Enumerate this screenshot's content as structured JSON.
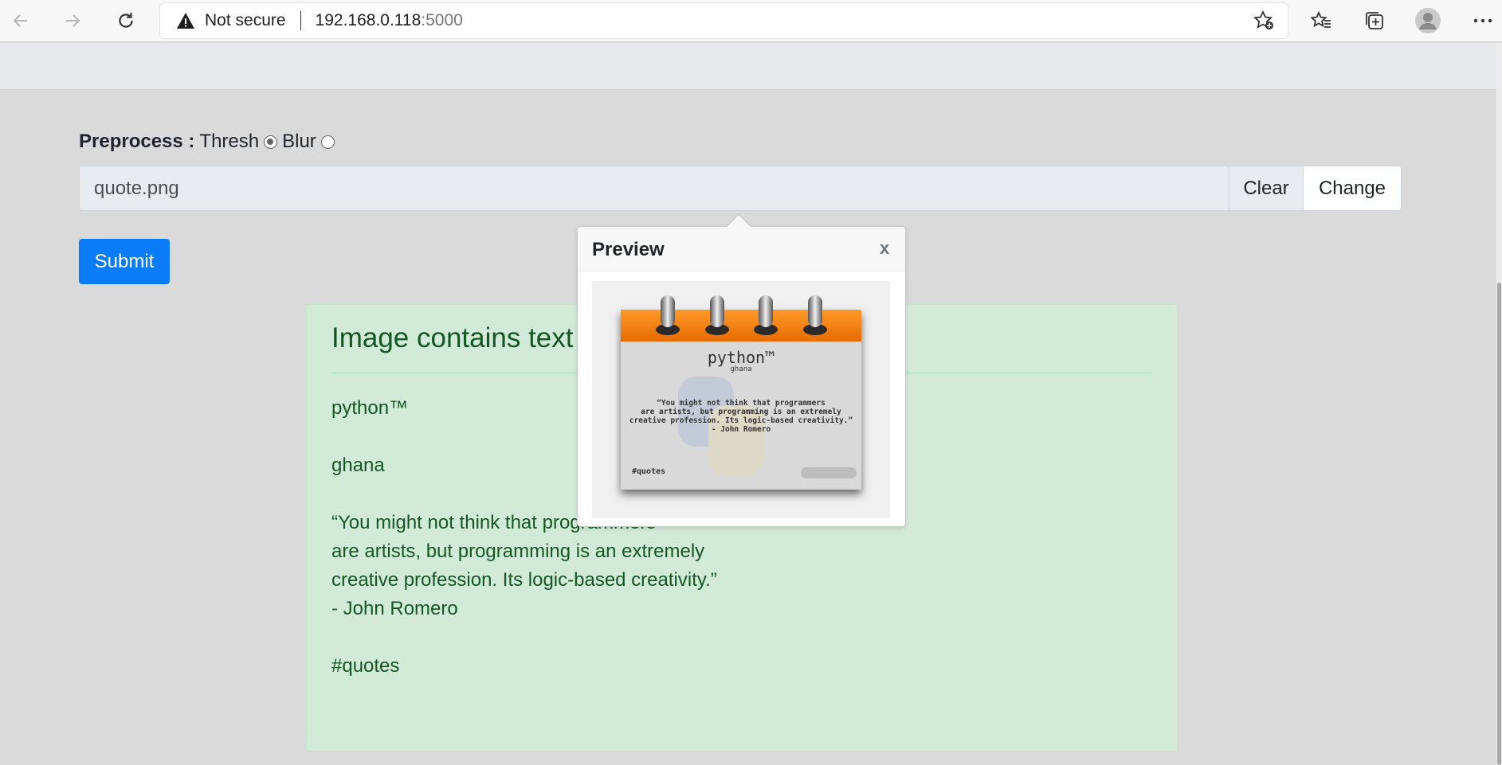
{
  "browser": {
    "security_label": "Not secure",
    "url_host": "192.168.0.118",
    "url_port": ":5000",
    "icons": [
      "back-icon",
      "forward-icon",
      "refresh-icon",
      "warning-icon",
      "add-favorite-icon",
      "favorites-icon",
      "collections-icon",
      "profile-icon",
      "more-icon"
    ]
  },
  "form": {
    "preprocess_label": "Preprocess :",
    "option_thresh": "Thresh",
    "option_blur": "Blur",
    "selected_option": "Thresh",
    "file_name": "quote.png",
    "clear_label": "Clear",
    "change_label": "Change",
    "submit_label": "Submit"
  },
  "result": {
    "heading": "Image contains text",
    "lines": [
      "python™",
      "",
      "ghana",
      "",
      "“You might not think that programmers",
      "are artists, but programming is an extremely",
      "creative profession. Its logic-based creativity.”",
      "- John Romero",
      "",
      "#quotes"
    ]
  },
  "popover": {
    "title": "Preview",
    "close_label": "x",
    "image": {
      "brand": "python™",
      "brand_sub": "ghana",
      "quote_lines": [
        "“You might not think that programmers",
        "are artists, but programming is an extremely",
        "creative profession. Its logic-based creativity.”",
        "- John Romero"
      ],
      "tag": "#quotes"
    }
  },
  "colors": {
    "submit_bg": "#0b7cf7",
    "alert_bg": "#d2ead8",
    "alert_text": "#155724",
    "calendar_orange": "#ff8c1a"
  }
}
